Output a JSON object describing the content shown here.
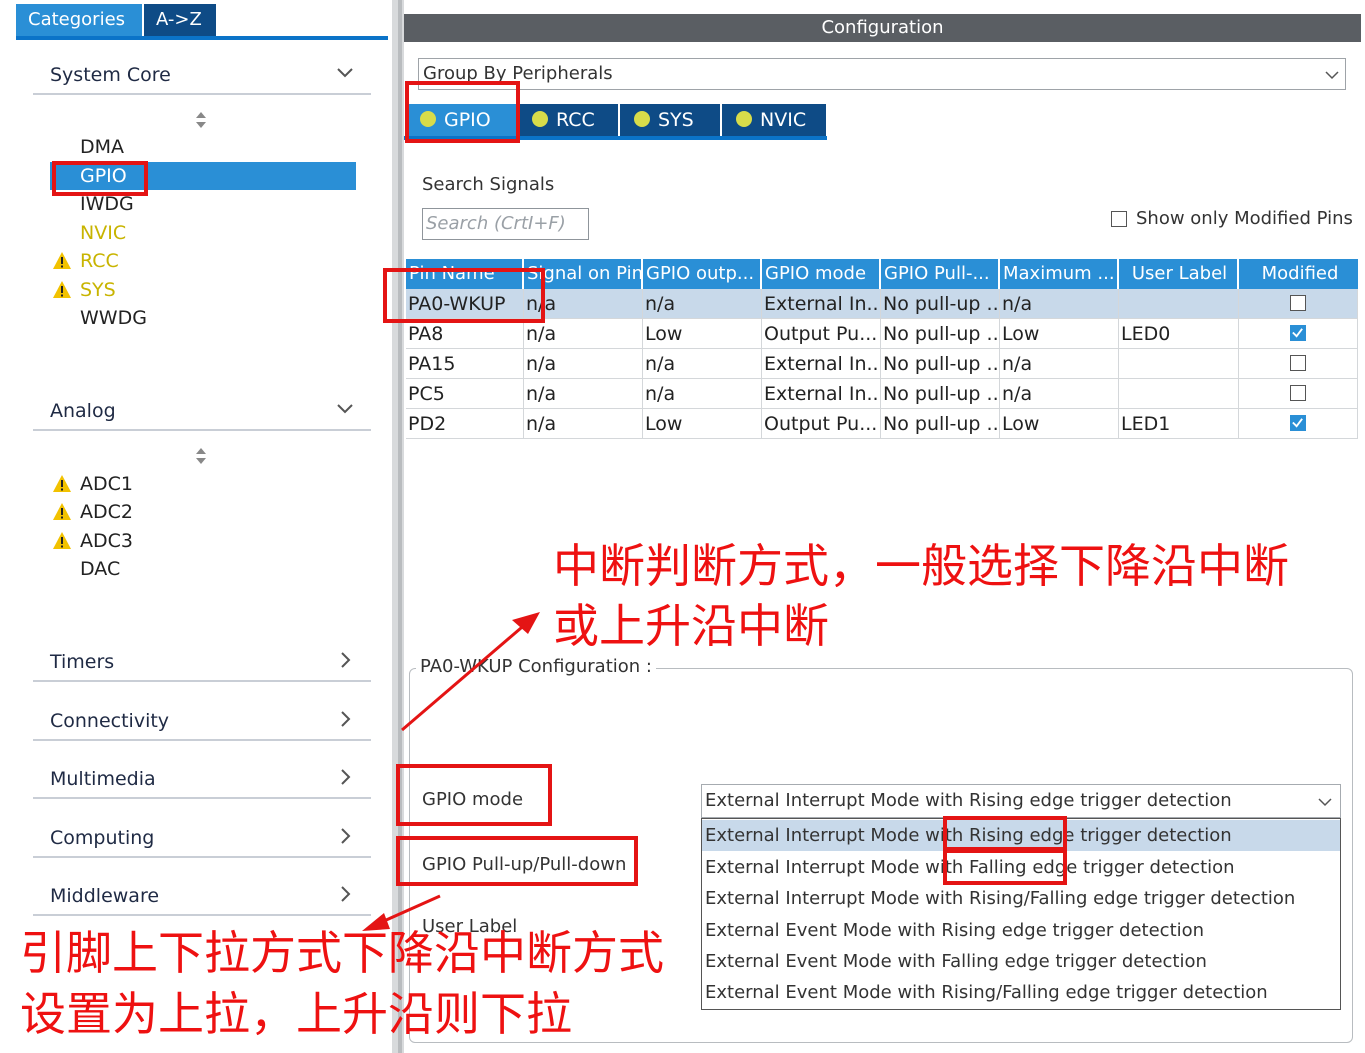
{
  "left_panel": {
    "tabs": [
      "Categories",
      "A->Z"
    ],
    "sections": {
      "system_core": "System Core",
      "analog": "Analog",
      "timers": "Timers",
      "connectivity": "Connectivity",
      "multimedia": "Multimedia",
      "computing": "Computing",
      "middleware": "Middleware"
    },
    "system_core_items": [
      "DMA",
      "GPIO",
      "IWDG",
      "NVIC",
      "RCC",
      "SYS",
      "WWDG"
    ],
    "analog_items": [
      "ADC1",
      "ADC2",
      "ADC3",
      "DAC"
    ],
    "selected_item": "GPIO"
  },
  "config": {
    "title": "Configuration",
    "group_by": "Group By Peripherals",
    "tabs": [
      "GPIO",
      "RCC",
      "SYS",
      "NVIC"
    ],
    "search_label": "Search Signals",
    "search_placeholder": "Search (CrtI+F)",
    "show_modified_label": "Show only Modified Pins",
    "table": {
      "headers": [
        "Pin Name",
        "Signal on Pin",
        "GPIO outp...",
        "GPIO mode",
        "GPIO Pull-...",
        "Maximum ...",
        "User Label",
        "Modified"
      ],
      "rows": [
        {
          "pin": "PA0-WKUP",
          "signal": "n/a",
          "output": "n/a",
          "mode": "External In...",
          "pull": "No pull-up ...",
          "max": "n/a",
          "label": "",
          "modified": false
        },
        {
          "pin": "PA8",
          "signal": "n/a",
          "output": "Low",
          "mode": "Output Pu...",
          "pull": "No pull-up ...",
          "max": "Low",
          "label": "LED0",
          "modified": true
        },
        {
          "pin": "PA15",
          "signal": "n/a",
          "output": "n/a",
          "mode": "External In...",
          "pull": "No pull-up ...",
          "max": "n/a",
          "label": "",
          "modified": false
        },
        {
          "pin": "PC5",
          "signal": "n/a",
          "output": "n/a",
          "mode": "External In...",
          "pull": "No pull-up ...",
          "max": "n/a",
          "label": "",
          "modified": false
        },
        {
          "pin": "PD2",
          "signal": "n/a",
          "output": "Low",
          "mode": "Output Pu...",
          "pull": "No pull-up ...",
          "max": "Low",
          "label": "LED1",
          "modified": true
        }
      ]
    },
    "pin_config_title": "PA0-WKUP Configuration :",
    "gpio_mode_label": "GPIO mode",
    "pull_label": "GPIO Pull-up/Pull-down",
    "user_label": "User Label",
    "mode_value": "External Interrupt Mode with Rising edge trigger detection",
    "mode_options": [
      "External Interrupt Mode with Rising edge trigger detection",
      "External Interrupt Mode with Falling edge trigger detection",
      "External Interrupt Mode with Rising/Falling edge trigger detection",
      "External Event Mode with Rising edge trigger detection",
      "External Event Mode with Falling edge trigger detection",
      "External Event Mode with Rising/Falling edge trigger detection"
    ]
  },
  "annotations": {
    "note1_line1": "中断判断方式，一般选择下降沿中断",
    "note1_line2": "或上升沿中断",
    "note2_line1": "引脚上下拉方式下降沿中断方式",
    "note2_line2": "设置为上拉，上升沿则下拉"
  },
  "colors": {
    "accent": "#2a8fd6",
    "tab_dark": "#0e4b86",
    "warn": "#c8b400",
    "annotation_red": "#e41414",
    "header_bar": "#5a5e63"
  }
}
